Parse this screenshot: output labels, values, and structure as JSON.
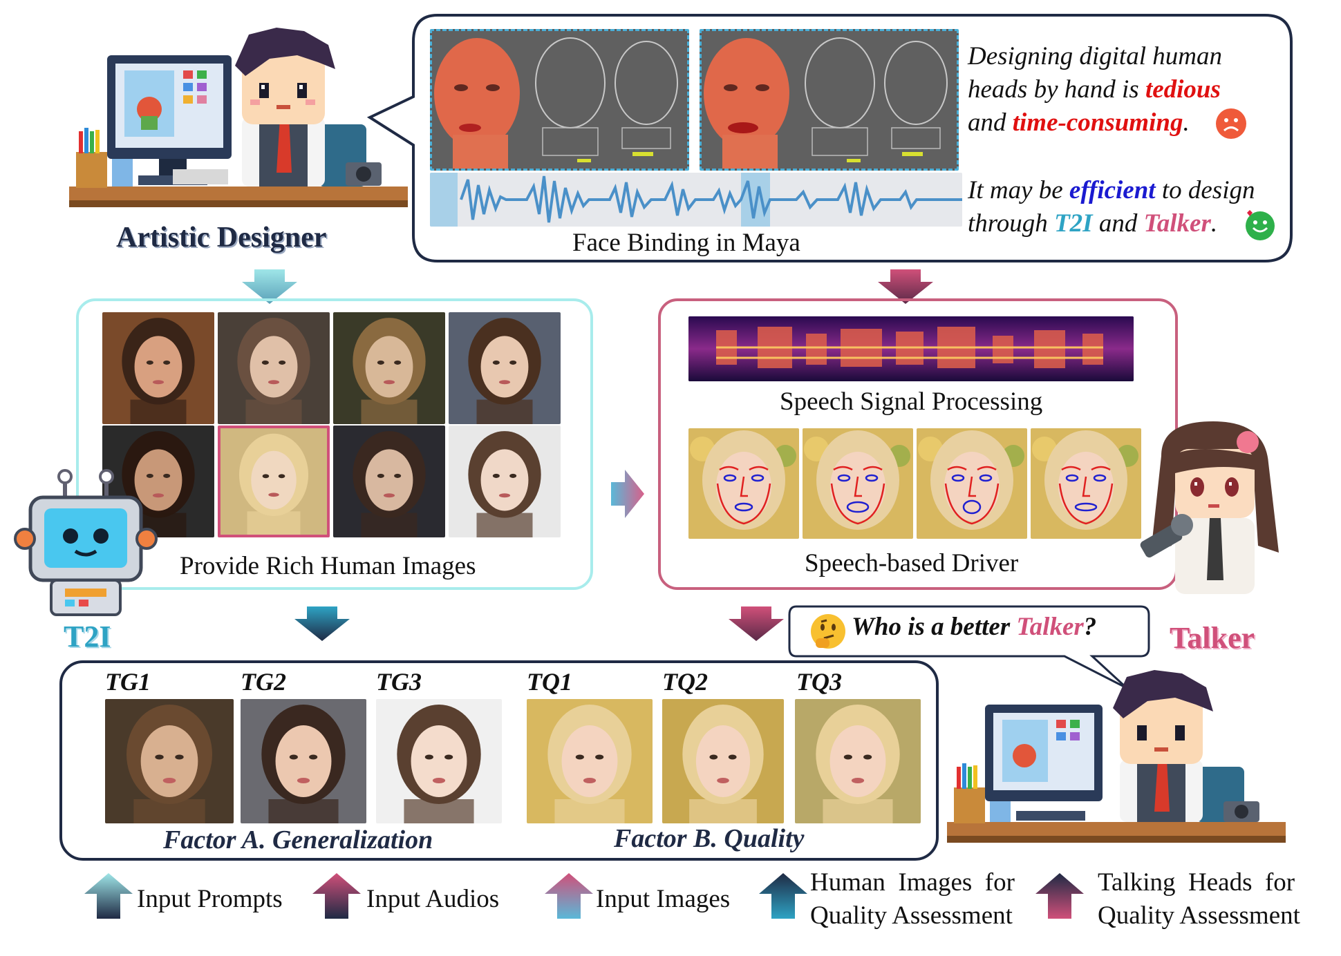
{
  "top": {
    "designer_label": "Artistic Designer",
    "maya_caption": "Face Binding in Maya",
    "bubble_line1": "Designing digital human",
    "bubble_line2": "heads by hand is",
    "bubble_word_tedious": "tedious",
    "bubble_line3_and": "and",
    "bubble_word_time": "time-consuming",
    "bubble_line3_end": ".",
    "bubble_line4_start": "It may be",
    "bubble_word_efficient": "efficient",
    "bubble_line4_end": "to design",
    "bubble_line5_start": "through",
    "bubble_word_t2i": "T2I",
    "bubble_line5_and": "and",
    "bubble_word_talker": "Talker",
    "bubble_line5_end": "."
  },
  "t2i_panel": {
    "caption": "Provide Rich Human Images",
    "agent_label": "T2I"
  },
  "talker_panel": {
    "speech_caption": "Speech Signal Processing",
    "driver_caption": "Speech-based Driver",
    "agent_label": "Talker",
    "question_start": "Who is a better",
    "question_word": "Talker",
    "question_end": "?"
  },
  "bottom_panel": {
    "groups": [
      {
        "label": "TG1"
      },
      {
        "label": "TG2"
      },
      {
        "label": "TG3"
      },
      {
        "label": "TQ1"
      },
      {
        "label": "TQ2"
      },
      {
        "label": "TQ3"
      }
    ],
    "factor_a": "Factor A. Generalization",
    "factor_b": "Factor B. Quality"
  },
  "legend": {
    "input_prompts": "Input Prompts",
    "input_audios": "Input Audios",
    "input_images": "Input Images",
    "human_images_line1": "Human  Images  for",
    "human_images_line2": "Quality Assessment",
    "talking_heads_line1": "Talking  Heads  for",
    "talking_heads_line2": "Quality Assessment"
  },
  "colors": {
    "navy": "#1f2a44",
    "cyan_panel": "#a8ecec",
    "pink_panel": "#c8607e",
    "red_emph": "#e01010",
    "blue_emph": "#1a1ad0",
    "t2i_cyan": "#2ea3c4",
    "talker_pink": "#d0507a"
  },
  "icons": [
    "sad-face-icon",
    "happy-face-icon",
    "thinking-face-icon",
    "robot-icon",
    "pixel-designer-icon",
    "pixel-girl-icon"
  ]
}
